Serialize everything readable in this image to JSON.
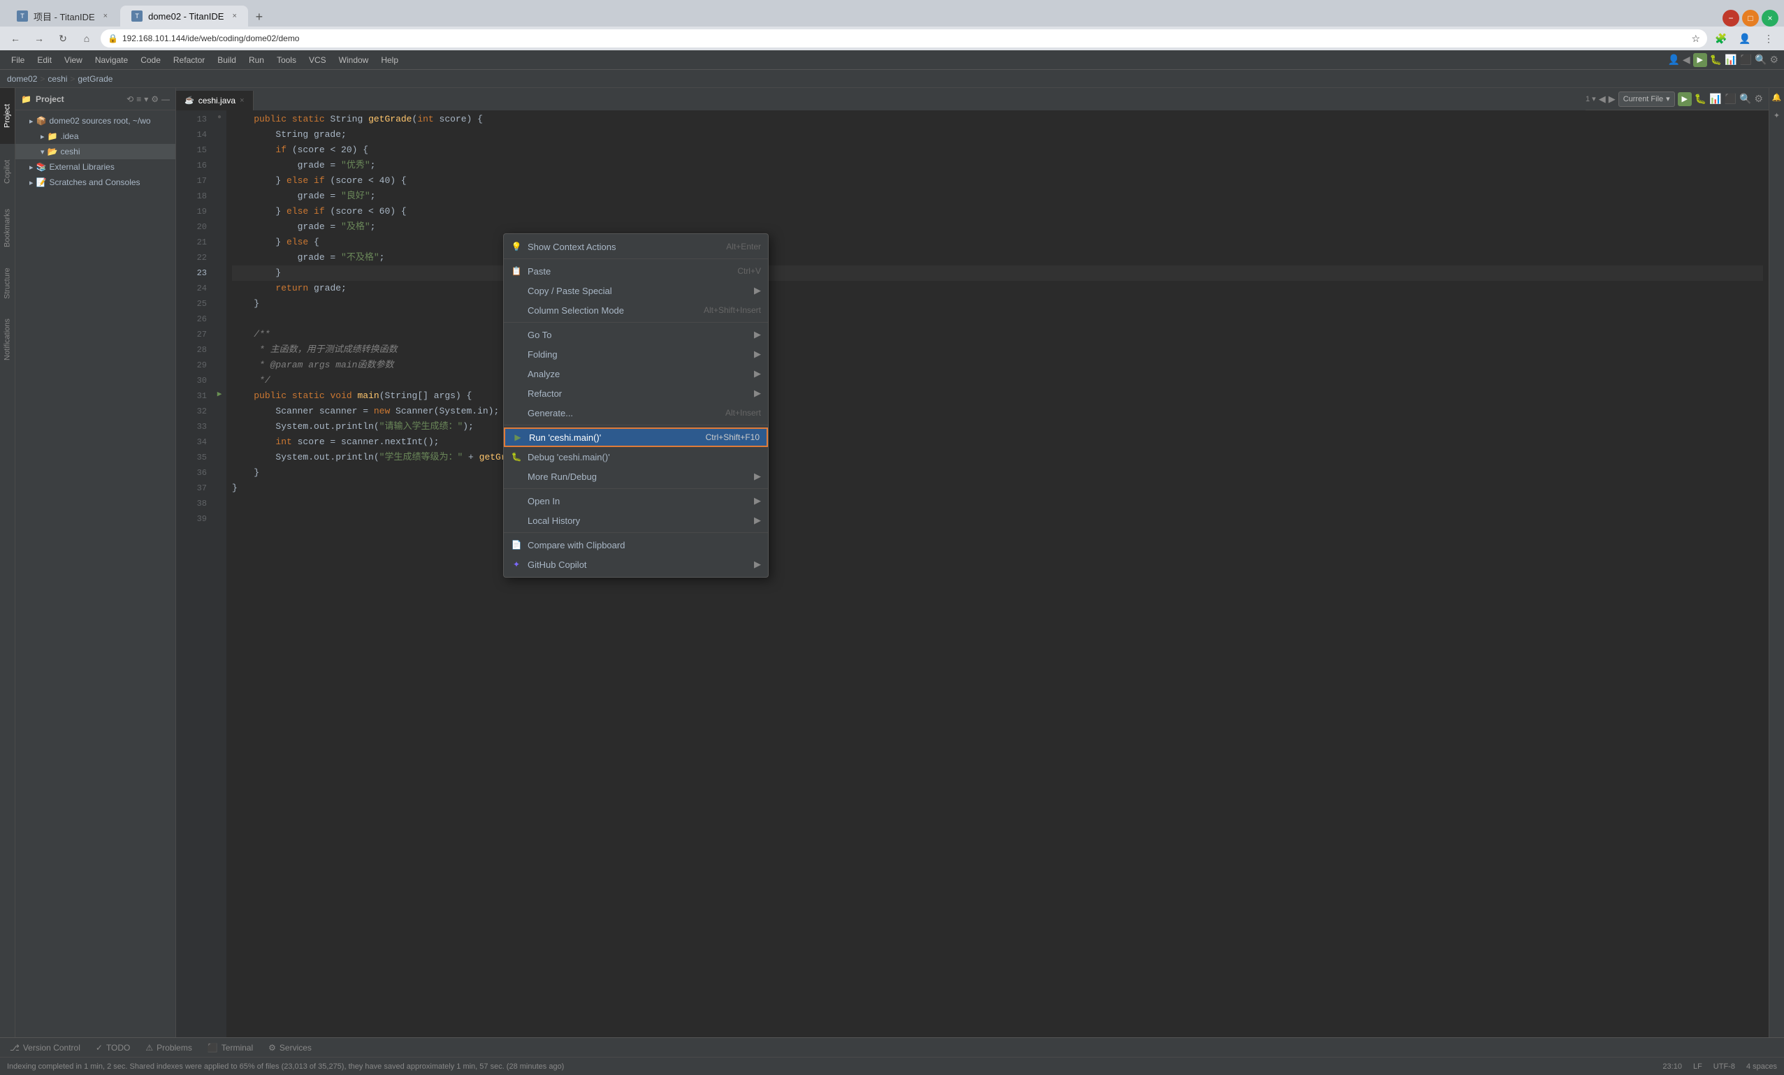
{
  "browser": {
    "tabs": [
      {
        "id": "tab1",
        "favicon": "T",
        "label": "项目 - TitanIDE",
        "active": false
      },
      {
        "id": "tab2",
        "favicon": "T",
        "label": "dome02 - TitanIDE",
        "active": true
      }
    ],
    "new_tab_label": "+",
    "url": "192.168.101.144/ide/web/coding/dome02/demo",
    "nav": {
      "back": "←",
      "forward": "→",
      "refresh": "↻",
      "home": "⌂"
    },
    "actions": {
      "bookmarks": "☆",
      "menu": "⋮"
    }
  },
  "ide": {
    "menubar": {
      "items": [
        "File",
        "Edit",
        "View",
        "Navigate",
        "Code",
        "Refactor",
        "Build",
        "Run",
        "Tools",
        "VCS",
        "Window",
        "Help"
      ]
    },
    "breadcrumb": {
      "parts": [
        "dome02",
        ">",
        "ceshi",
        ">",
        "getGrade"
      ]
    },
    "project_panel": {
      "title": "Project",
      "items": [
        {
          "label": "dome02  sources root, ~/wo",
          "indent": 1,
          "icon": "▸",
          "type": "project"
        },
        {
          "label": ".idea",
          "indent": 2,
          "icon": "▸",
          "type": "folder"
        },
        {
          "label": "ceshi",
          "indent": 2,
          "icon": "▾",
          "type": "folder",
          "selected": true
        },
        {
          "label": "External Libraries",
          "indent": 1,
          "icon": "▸",
          "type": "folder"
        },
        {
          "label": "Scratches and Consoles",
          "indent": 1,
          "icon": "▸",
          "type": "folder"
        }
      ]
    },
    "editor": {
      "tabs": [
        {
          "label": "ceshi.java",
          "active": true,
          "close": "×"
        }
      ],
      "toolbar": {
        "current_file_label": "Current File",
        "dropdown_arrow": "▾"
      },
      "lines": [
        {
          "ln": 13,
          "gutter": "●",
          "code": "    public static String <fn>getGrade</fn>(<type>int</type> score) {"
        },
        {
          "ln": 14,
          "gutter": " ",
          "code": "        String grade;"
        },
        {
          "ln": 15,
          "gutter": " ",
          "code": "        if (score < 20) {"
        },
        {
          "ln": 16,
          "gutter": " ",
          "code": "            grade = \"优秀\";"
        },
        {
          "ln": 17,
          "gutter": " ",
          "code": "        } else if (score < 40) {"
        },
        {
          "ln": 18,
          "gutter": " ",
          "code": "            grade = \"良好\";"
        },
        {
          "ln": 19,
          "gutter": " ",
          "code": "        } else if (score < 60) {"
        },
        {
          "ln": 20,
          "gutter": " ",
          "code": "            grade = \"及格\";"
        },
        {
          "ln": 21,
          "gutter": " ",
          "code": "        } else {"
        },
        {
          "ln": 22,
          "gutter": " ",
          "code": "            grade = \"不及格\";"
        },
        {
          "ln": 23,
          "gutter": " ",
          "code": "        }"
        },
        {
          "ln": 24,
          "gutter": " ",
          "code": "        return grade;"
        },
        {
          "ln": 25,
          "gutter": " ",
          "code": "    }"
        },
        {
          "ln": 26,
          "gutter": " ",
          "code": ""
        },
        {
          "ln": 27,
          "gutter": " ",
          "code": "    /**"
        },
        {
          "ln": 28,
          "gutter": " ",
          "code": "     * 主函数，用于测试成绩转换函数"
        },
        {
          "ln": 29,
          "gutter": " ",
          "code": "     * @param args main函数参数"
        },
        {
          "ln": 30,
          "gutter": " ",
          "code": "     */"
        },
        {
          "ln": 31,
          "gutter": "▶",
          "code": "    public static void <fn>main</fn>(String[] args) {"
        },
        {
          "ln": 32,
          "gutter": " ",
          "code": "        Scanner scanner = new Scanner(System.in);"
        },
        {
          "ln": 33,
          "gutter": " ",
          "code": "        System.out.println(\"请输入学生成绩：\");"
        },
        {
          "ln": 34,
          "gutter": " ",
          "code": "        int score = scanner.nextInt();"
        },
        {
          "ln": 35,
          "gutter": " ",
          "code": "        System.out.println(\"学生成绩等级为：\" + <fn>getGrade</fn>(score"
        },
        {
          "ln": 36,
          "gutter": " ",
          "code": "    }"
        },
        {
          "ln": 37,
          "gutter": " ",
          "code": "}"
        },
        {
          "ln": 38,
          "gutter": " ",
          "code": ""
        },
        {
          "ln": 39,
          "gutter": " ",
          "code": ""
        }
      ]
    },
    "context_menu": {
      "items": [
        {
          "id": "show-context-actions",
          "label": "Show Context Actions",
          "shortcut": "Alt+Enter",
          "icon": "💡",
          "arrow": false,
          "divider": false
        },
        {
          "id": "paste",
          "label": "Paste",
          "shortcut": "Ctrl+V",
          "icon": "📋",
          "arrow": false,
          "divider": false
        },
        {
          "id": "copy-paste-special",
          "label": "Copy / Paste Special",
          "shortcut": "",
          "icon": "",
          "arrow": true,
          "divider": false
        },
        {
          "id": "column-selection",
          "label": "Column Selection Mode",
          "shortcut": "Alt+Shift+Insert",
          "icon": "",
          "arrow": false,
          "divider": true
        },
        {
          "id": "go-to",
          "label": "Go To",
          "shortcut": "",
          "icon": "",
          "arrow": true,
          "divider": false
        },
        {
          "id": "folding",
          "label": "Folding",
          "shortcut": "",
          "icon": "",
          "arrow": true,
          "divider": false
        },
        {
          "id": "analyze",
          "label": "Analyze",
          "shortcut": "",
          "icon": "",
          "arrow": true,
          "divider": false
        },
        {
          "id": "refactor",
          "label": "Refactor",
          "shortcut": "",
          "icon": "",
          "arrow": true,
          "divider": false
        },
        {
          "id": "generate",
          "label": "Generate...",
          "shortcut": "Alt+Insert",
          "icon": "",
          "arrow": false,
          "divider": true
        },
        {
          "id": "run-main",
          "label": "Run 'ceshi.main()'",
          "shortcut": "Ctrl+Shift+F10",
          "icon": "▶",
          "arrow": false,
          "divider": false,
          "highlighted": true
        },
        {
          "id": "debug-main",
          "label": "Debug 'ceshi.main()'",
          "shortcut": "",
          "icon": "🐛",
          "arrow": false,
          "divider": false
        },
        {
          "id": "more-run",
          "label": "More Run/Debug",
          "shortcut": "",
          "icon": "",
          "arrow": true,
          "divider": true
        },
        {
          "id": "open-in",
          "label": "Open In",
          "shortcut": "",
          "icon": "",
          "arrow": true,
          "divider": false
        },
        {
          "id": "local-history",
          "label": "Local History",
          "shortcut": "",
          "icon": "",
          "arrow": true,
          "divider": true
        },
        {
          "id": "compare-clipboard",
          "label": "Compare with Clipboard",
          "shortcut": "",
          "icon": "📄",
          "arrow": false,
          "divider": false
        },
        {
          "id": "github-copilot",
          "label": "GitHub Copilot",
          "shortcut": "",
          "icon": "✦",
          "arrow": true,
          "divider": false
        }
      ]
    },
    "statusbar": {
      "message": "Indexing completed in 1 min, 2 sec. Shared indexes were applied to 65% of files (23,013 of 35,275), they have saved approximately 1 min, 57 sec. (28 minutes ago)",
      "position": "23:10",
      "encoding": "UTF-8",
      "line_ending": "LF",
      "indent": "4 spaces"
    },
    "bottombar": {
      "tabs": [
        {
          "label": "Version Control",
          "icon": ""
        },
        {
          "label": "TODO",
          "icon": ""
        },
        {
          "label": "Problems",
          "icon": "⚠"
        },
        {
          "label": "Terminal",
          "icon": ""
        },
        {
          "label": "Services",
          "icon": ""
        }
      ]
    }
  }
}
